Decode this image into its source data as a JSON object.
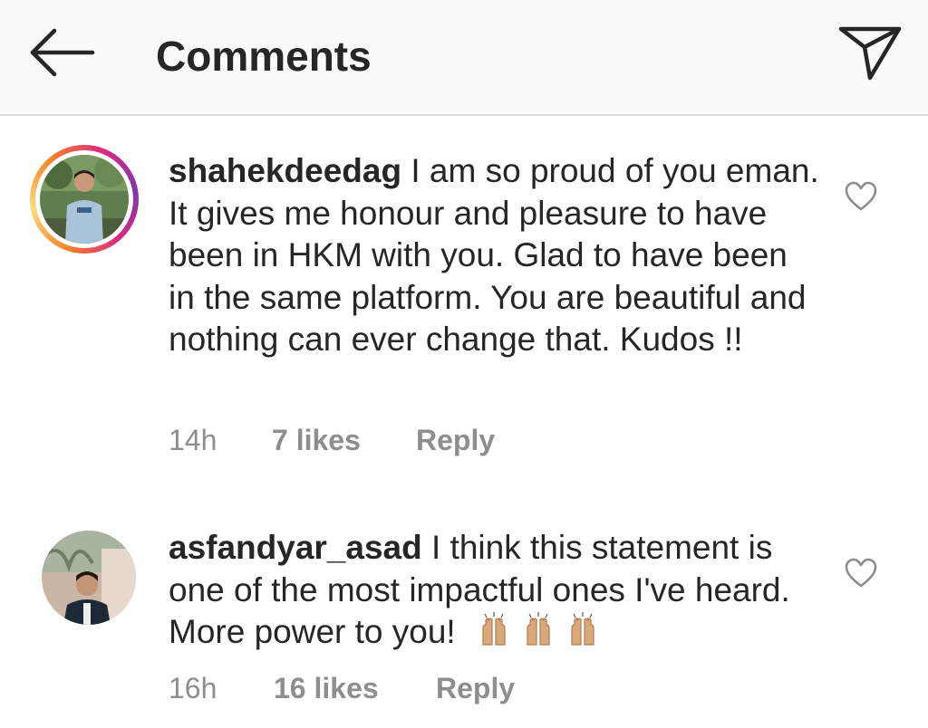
{
  "header": {
    "title": "Comments",
    "back_icon": "back-arrow-icon",
    "send_icon": "paper-plane-icon"
  },
  "comments": [
    {
      "username": "shahekdeedag",
      "text": "I am so proud of you eman. It gives me honour and pleasure to have been in HKM with you. Glad to have been in the same platform. You are beautiful and nothing can ever change that. Kudos !!",
      "time": "14h",
      "likes": "7 likes",
      "reply": "Reply",
      "has_story_ring": true
    },
    {
      "username": "asfandyar_asad",
      "text": "I think this statement is one of the most impactful ones I've heard. More power to you!",
      "time": "16h",
      "likes": "16 likes",
      "reply": "Reply",
      "emoji": "raised-hands-emoji x3",
      "has_story_ring": false
    }
  ],
  "colors": {
    "text": "#262626",
    "meta": "#8e8e8e",
    "header_bg": "#fafafa",
    "divider": "#dbdbdb"
  }
}
